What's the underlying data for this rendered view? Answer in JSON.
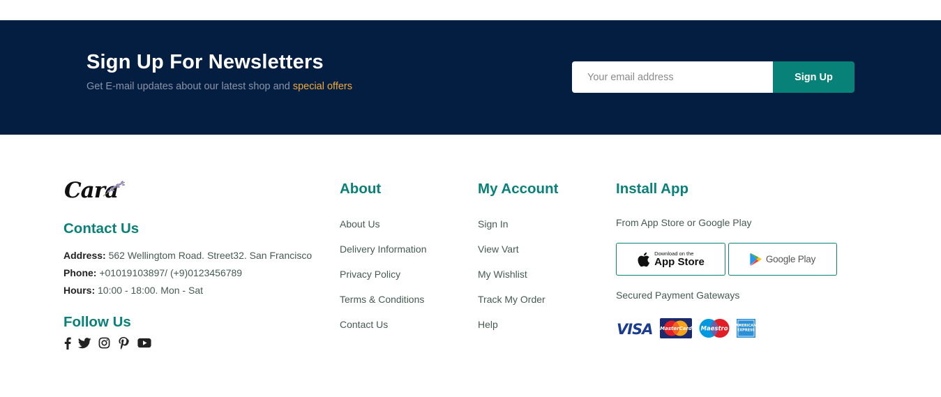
{
  "newsletter": {
    "title": "Sign Up For Newsletters",
    "subtitle_prefix": "Get E-mail updates about our latest shop and ",
    "subtitle_accent": "special offers",
    "email_placeholder": "Your email address",
    "button_label": "Sign Up"
  },
  "brand": {
    "logo_text": "Cara"
  },
  "contact": {
    "title": "Contact Us",
    "address_label": "Address:",
    "address_value": " 562 Wellingtom Road. Street32. San Francisco",
    "phone_label": "Phone:",
    "phone_value": " +01019103897/ (+9)0123456789",
    "hours_label": "Hours:",
    "hours_value": " 10:00 - 18:00. Mon - Sat"
  },
  "follow": {
    "title": "Follow Us",
    "icons": [
      "facebook-icon",
      "twitter-icon",
      "instagram-icon",
      "pinterest-icon",
      "youtube-icon"
    ]
  },
  "about": {
    "title": "About",
    "links": [
      "About Us",
      "Delivery Information",
      "Privacy Policy",
      "Terms & Conditions",
      "Contact Us"
    ]
  },
  "account": {
    "title": "My Account",
    "links": [
      "Sign In",
      "View Vart",
      "My Wishlist",
      "Track My Order",
      "Help"
    ]
  },
  "install": {
    "title": "Install App",
    "caption": "From App Store or Google Play",
    "app_store_small": "Download on the",
    "app_store_big": "App Store",
    "google_play": "Google Play",
    "payments_caption": "Secured Payment Gateways",
    "payment_methods": [
      "VISA",
      "MasterCard",
      "Maestro",
      "AMERICAN EXPRESS"
    ]
  },
  "colors": {
    "brand": "#088178",
    "band": "#041e42",
    "accent": "#f2a93b"
  }
}
